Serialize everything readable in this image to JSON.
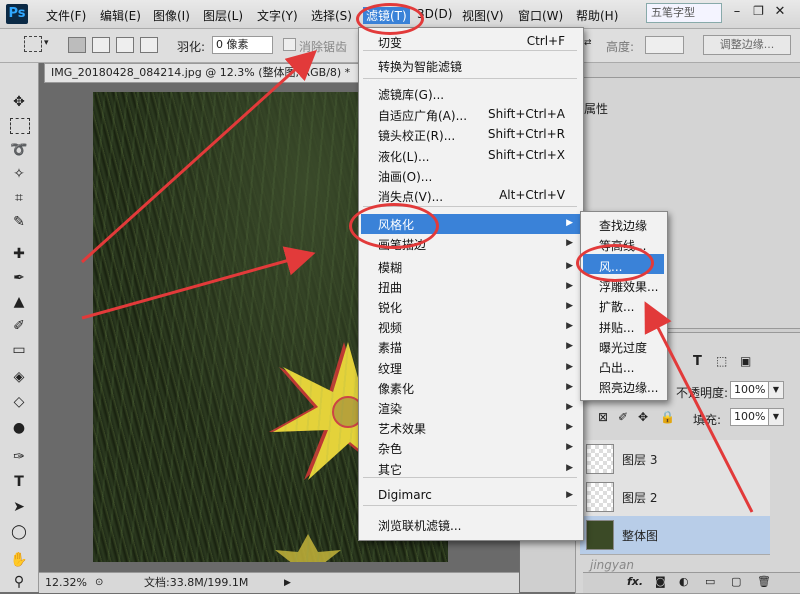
{
  "menubar": {
    "logo": "Ps",
    "items": [
      "文件(F)",
      "编辑(E)",
      "图像(I)",
      "图层(L)",
      "文字(Y)",
      "选择(S)",
      "滤镜(T)",
      "3D(D)",
      "视图(V)",
      "窗口(W)",
      "帮助(H)"
    ],
    "watermark": "五笔字型"
  },
  "options": {
    "feather_label": "羽化:",
    "feather_value": "0 像素",
    "antialias_label": "消除锯齿",
    "height_label": "高度:",
    "refine_edge": "调整边缘..."
  },
  "document": {
    "tab_title": "IMG_20180428_084214.jpg @ 12.3% (整体图, RGB/8) *",
    "zoom": "12.32%",
    "doc_info": "文档:33.8M/199.1M"
  },
  "filter_menu": {
    "items": [
      {
        "label": "切变",
        "shortcut": "Ctrl+F"
      },
      {
        "label": "转换为智能滤镜",
        "shortcut": ""
      },
      {
        "label": "滤镜库(G)...",
        "shortcut": ""
      },
      {
        "label": "自适应广角(A)...",
        "shortcut": "Shift+Ctrl+A"
      },
      {
        "label": "镜头校正(R)...",
        "shortcut": "Shift+Ctrl+R"
      },
      {
        "label": "液化(L)...",
        "shortcut": "Shift+Ctrl+X"
      },
      {
        "label": "油画(O)...",
        "shortcut": ""
      },
      {
        "label": "消失点(V)...",
        "shortcut": "Alt+Ctrl+V"
      },
      {
        "label": "风格化",
        "shortcut": ""
      },
      {
        "label": "画笔描边",
        "shortcut": ""
      },
      {
        "label": "模糊",
        "shortcut": ""
      },
      {
        "label": "扭曲",
        "shortcut": ""
      },
      {
        "label": "锐化",
        "shortcut": ""
      },
      {
        "label": "视频",
        "shortcut": ""
      },
      {
        "label": "素描",
        "shortcut": ""
      },
      {
        "label": "纹理",
        "shortcut": ""
      },
      {
        "label": "像素化",
        "shortcut": ""
      },
      {
        "label": "渲染",
        "shortcut": ""
      },
      {
        "label": "艺术效果",
        "shortcut": ""
      },
      {
        "label": "杂色",
        "shortcut": ""
      },
      {
        "label": "其它",
        "shortcut": ""
      },
      {
        "label": "Digimarc",
        "shortcut": ""
      },
      {
        "label": "浏览联机滤镜...",
        "shortcut": ""
      }
    ]
  },
  "stylize_submenu": {
    "items": [
      "查找边缘",
      "等高线...",
      "风...",
      "浮雕效果...",
      "扩散...",
      "拼贴...",
      "曝光过度",
      "凸出...",
      "照亮边缘..."
    ]
  },
  "properties_panel": {
    "title": "属性"
  },
  "layers_panel": {
    "opacity_label": "不透明度:",
    "opacity_value": "100%",
    "fill_label": "填充:",
    "fill_value": "100%",
    "layers": [
      "图层 3",
      "图层 2",
      "整体图"
    ],
    "footer": "jingyan"
  },
  "colors": {
    "highlight": "#3a82d8",
    "annotation": "#e23a3a"
  }
}
